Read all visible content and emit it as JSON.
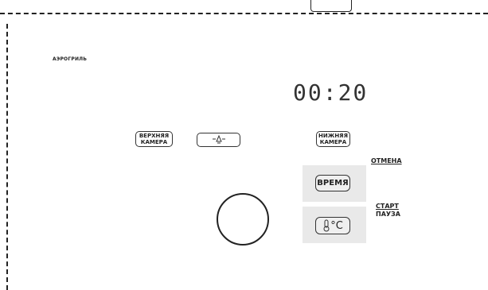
{
  "panel": {
    "mode_label": "АЭРОГРИЛЬ",
    "timer_display": "00:20"
  },
  "buttons": {
    "upper_chamber": [
      "ВЕРХНЯЯ",
      "КАМЕРА"
    ],
    "lower_chamber": [
      "НИЖНЯЯ",
      "КАМЕРА"
    ],
    "time": "ВРЕМЯ",
    "temperature_unit": "°C",
    "cancel": "ОТМЕНА",
    "start": "СТАРТ",
    "pause": "ПАУЗА"
  },
  "icons": {
    "light": "lamp-icon",
    "thermometer": "thermometer-icon",
    "knob": "dial-knob"
  },
  "colors": {
    "panel_bg": "#e9e9e9",
    "line": "#222222"
  }
}
